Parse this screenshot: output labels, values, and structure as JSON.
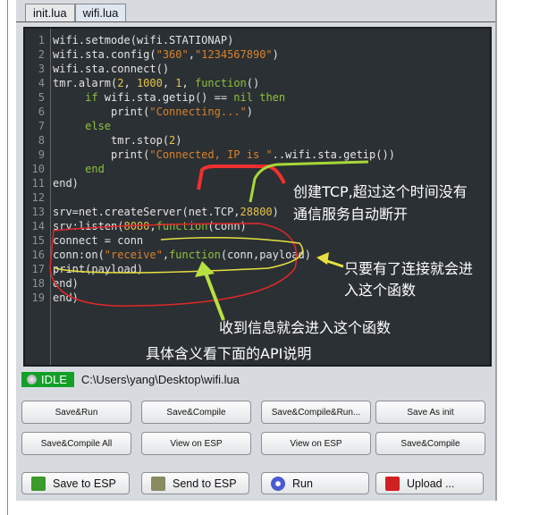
{
  "tabs": [
    {
      "label": "init.lua",
      "active": false
    },
    {
      "label": "wifi.lua",
      "active": true
    }
  ],
  "code": [
    [
      [
        "wifi.setmode(wifi.STATIONAP)",
        ""
      ]
    ],
    [
      [
        "wifi.sta.config(",
        ""
      ],
      [
        "\"360\"",
        "s"
      ],
      [
        ",",
        ""
      ],
      [
        "\"1234567890\"",
        "s"
      ],
      [
        ")",
        ""
      ]
    ],
    [
      [
        "wifi.sta.connect()",
        ""
      ]
    ],
    [
      [
        "tmr.alarm(",
        ""
      ],
      [
        "2",
        "n"
      ],
      [
        ", ",
        ""
      ],
      [
        "1000",
        "n"
      ],
      [
        ", ",
        ""
      ],
      [
        "1",
        "n"
      ],
      [
        ", ",
        ""
      ],
      [
        "function",
        "k"
      ],
      [
        "()",
        ""
      ]
    ],
    [
      [
        "     ",
        ""
      ],
      [
        "if",
        "k"
      ],
      [
        " wifi.sta.getip() == ",
        ""
      ],
      [
        "nil",
        "k"
      ],
      [
        " ",
        ""
      ],
      [
        "then",
        "k"
      ]
    ],
    [
      [
        "         print(",
        ""
      ],
      [
        "\"Connecting...\"",
        "s"
      ],
      [
        ")",
        ""
      ]
    ],
    [
      [
        "     ",
        ""
      ],
      [
        "else",
        "k"
      ]
    ],
    [
      [
        "         tmr.stop(",
        ""
      ],
      [
        "2",
        "n"
      ],
      [
        ")",
        ""
      ]
    ],
    [
      [
        "         print(",
        ""
      ],
      [
        "\"Connected, IP is \"",
        "s"
      ],
      [
        "..wifi.sta.getip())",
        ""
      ]
    ],
    [
      [
        "     ",
        ""
      ],
      [
        "end",
        "k"
      ]
    ],
    [
      [
        "end)",
        ""
      ]
    ],
    [
      [
        "",
        ""
      ]
    ],
    [
      [
        "srv=net.createServer(net.TCP,",
        ""
      ],
      [
        "28800",
        "n"
      ],
      [
        ")",
        ""
      ]
    ],
    [
      [
        "srv:listen(",
        ""
      ],
      [
        "8080",
        "n"
      ],
      [
        ",",
        ""
      ],
      [
        "function",
        "k"
      ],
      [
        "(conn)",
        ""
      ]
    ],
    [
      [
        "connect = conn",
        ""
      ]
    ],
    [
      [
        "conn:on(",
        ""
      ],
      [
        "\"receive\"",
        "s"
      ],
      [
        ",",
        ""
      ],
      [
        "function",
        "k"
      ],
      [
        "(conn,payload)",
        ""
      ]
    ],
    [
      [
        "print(payload)",
        ""
      ]
    ],
    [
      [
        "end)",
        ""
      ]
    ],
    [
      [
        "end)",
        ""
      ]
    ]
  ],
  "status": {
    "state": "IDLE",
    "path": "C:\\Users\\yang\\Desktop\\wifi.lua"
  },
  "buttons_row1": [
    "Save&Run",
    "Save&Compile",
    "Save&Compile&Run...",
    "Save As init"
  ],
  "buttons_row2": [
    "Save&Compile All",
    "View on ESP",
    "View on ESP",
    "Save&Compile"
  ],
  "buttons_row3": [
    {
      "label": "Save to ESP",
      "icon": "save-to-esp-icon"
    },
    {
      "label": "Send to ESP",
      "icon": "send-script-icon"
    },
    {
      "label": "Run",
      "icon": "run-icon"
    },
    {
      "label": "Upload ...",
      "icon": "upload-icon"
    }
  ],
  "annotations": {
    "tcp1": "创建TCP,超过这个时间没有",
    "tcp2": "通信服务自动断开",
    "conn1": "只要有了连接就会进",
    "conn2": "入这个函数",
    "recv": "收到信息就会进入这个函数",
    "api": "具体含义看下面的API说明"
  },
  "colors": {
    "status_idle": "#12a028",
    "editor_bg": "#2b3034",
    "keyword": "#8fc23b",
    "string": "#d9822b",
    "number": "#e8c449"
  }
}
